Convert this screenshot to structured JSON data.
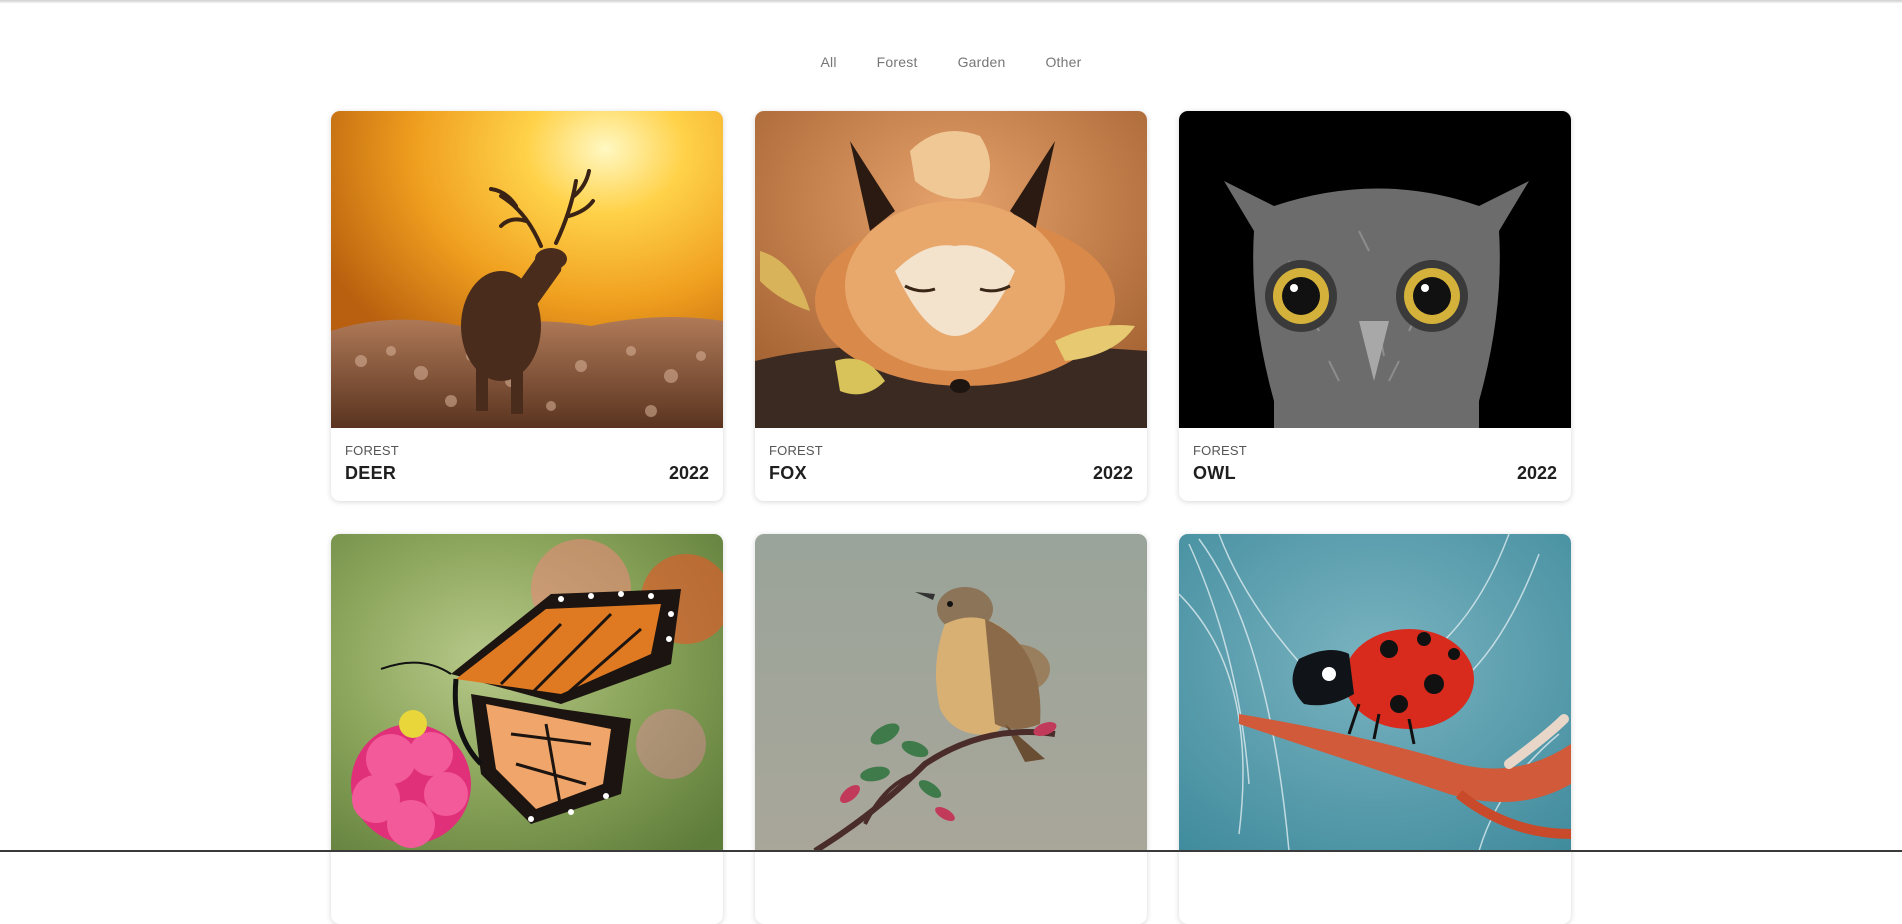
{
  "filters": {
    "items": [
      "All",
      "Forest",
      "Garden",
      "Other"
    ]
  },
  "cards": [
    {
      "category": "FOREST",
      "name": "DEER",
      "year": "2022",
      "image": "deer-at-sunset"
    },
    {
      "category": "FOREST",
      "name": "FOX",
      "year": "2022",
      "image": "sleeping-fox"
    },
    {
      "category": "FOREST",
      "name": "OWL",
      "year": "2022",
      "image": "owl-portrait"
    },
    {
      "category": "",
      "name": "",
      "year": "",
      "image": "monarch-butterfly-on-flower"
    },
    {
      "category": "",
      "name": "",
      "year": "",
      "image": "bird-on-branch"
    },
    {
      "category": "",
      "name": "",
      "year": "",
      "image": "ladybug-on-dandelion"
    }
  ],
  "colors": {
    "filter_text": "#777777",
    "title_text": "#1f1f1f",
    "card_shadow": "rgba(0,0,0,0.16)"
  }
}
